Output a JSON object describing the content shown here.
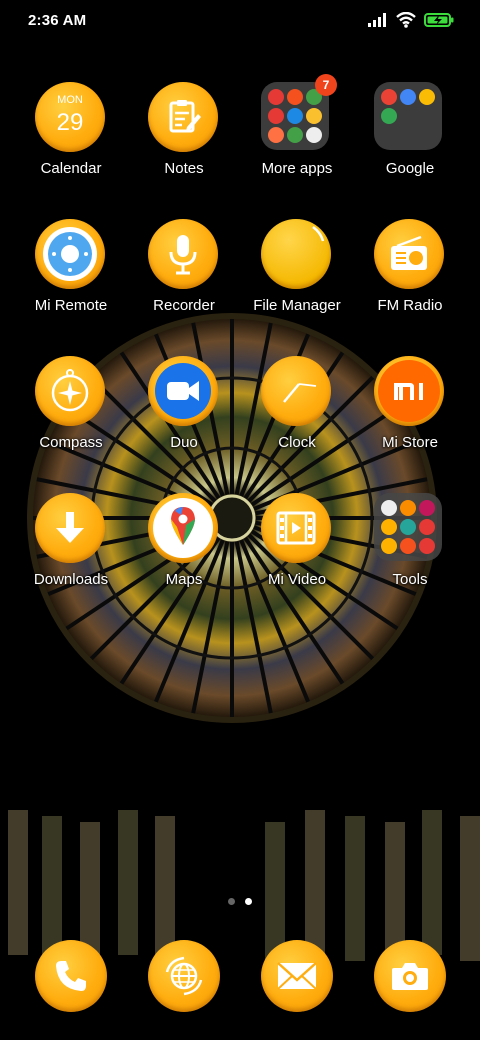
{
  "status_bar": {
    "time": "2:36 AM",
    "icons": [
      "signal-icon",
      "wifi-icon",
      "battery-charging-icon"
    ]
  },
  "apps": [
    {
      "label": "Calendar",
      "icon": "calendar-icon",
      "month": "MON",
      "day": "29"
    },
    {
      "label": "Notes",
      "icon": "notes-icon"
    },
    {
      "label": "More apps",
      "icon": "folder-icon",
      "badge": "7"
    },
    {
      "label": "Google",
      "icon": "folder-icon"
    },
    {
      "label": "Mi Remote",
      "icon": "remote-icon"
    },
    {
      "label": "Recorder",
      "icon": "microphone-icon"
    },
    {
      "label": "File Manager",
      "icon": "folder-file-icon"
    },
    {
      "label": "FM Radio",
      "icon": "radio-icon"
    },
    {
      "label": "Compass",
      "icon": "compass-icon"
    },
    {
      "label": "Duo",
      "icon": "video-camera-icon"
    },
    {
      "label": "Clock",
      "icon": "clock-icon"
    },
    {
      "label": "Mi Store",
      "icon": "mi-logo-icon",
      "logo_text": "mi"
    },
    {
      "label": "Downloads",
      "icon": "download-arrow-icon"
    },
    {
      "label": "Maps",
      "icon": "map-pin-icon"
    },
    {
      "label": "Mi Video",
      "icon": "film-icon"
    },
    {
      "label": "Tools",
      "icon": "folder-icon"
    }
  ],
  "page_indicator": {
    "pages": 2,
    "current": 2
  },
  "dock": [
    {
      "name": "phone",
      "icon": "phone-icon"
    },
    {
      "name": "browser",
      "icon": "globe-icon"
    },
    {
      "name": "messages",
      "icon": "envelope-icon"
    },
    {
      "name": "camera",
      "icon": "camera-icon"
    }
  ],
  "colors": {
    "icon_orange": "#ffad0f",
    "icon_orange_light": "#ffcf40",
    "badge_red": "#f0441c",
    "duo_blue": "#1a73e8",
    "mi_orange": "#ff6900",
    "remote_blue": "#4fa8ef",
    "battery_green": "#3ddc3d"
  }
}
